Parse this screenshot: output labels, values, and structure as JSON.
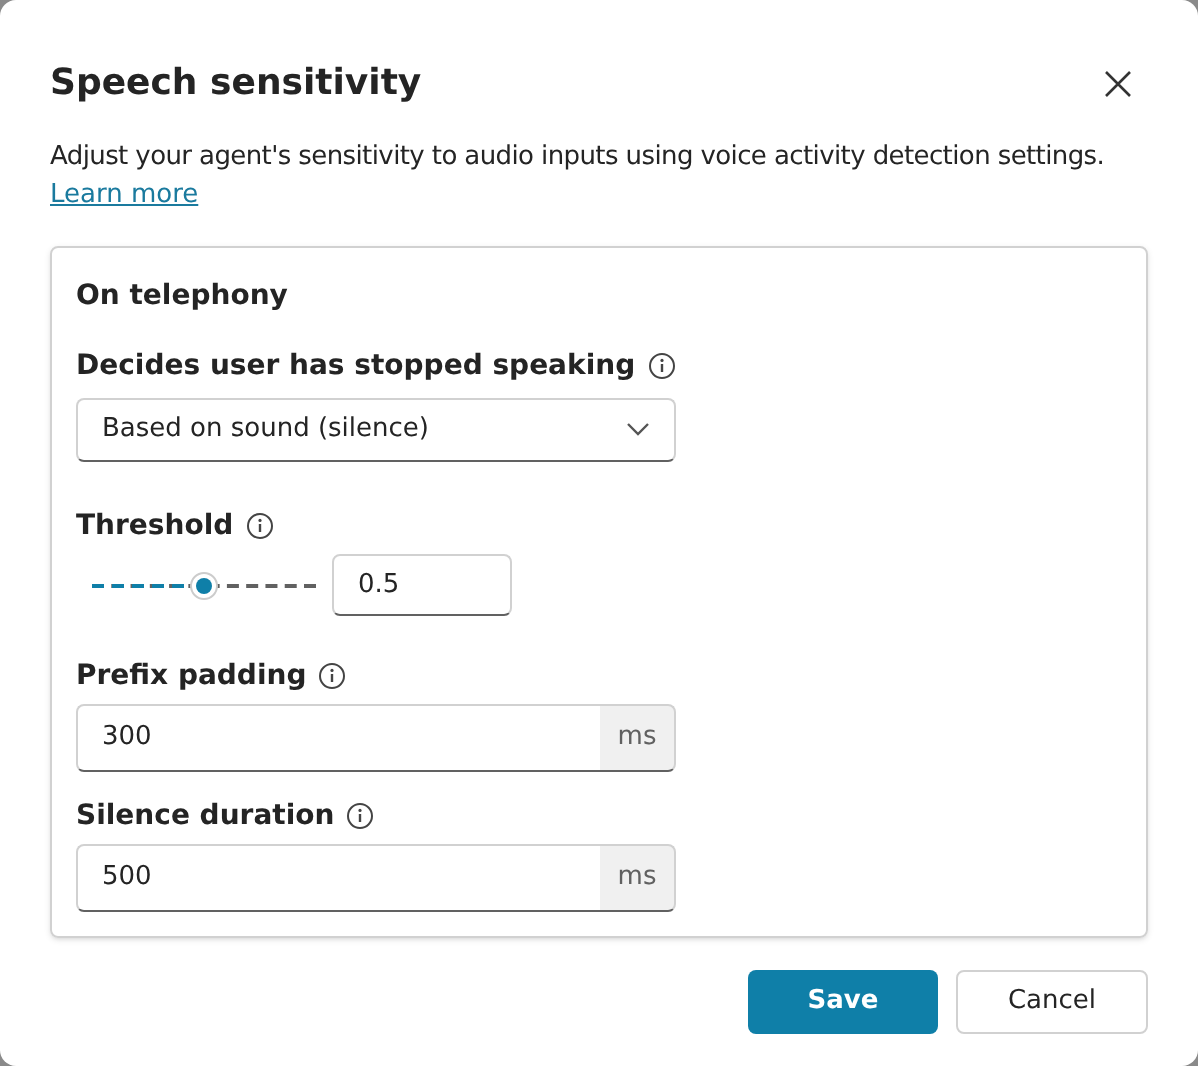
{
  "dialog": {
    "title": "Speech sensitivity",
    "description": "Adjust your agent's sensitivity to audio inputs using voice activity detection settings.",
    "link": "Learn more"
  },
  "section": {
    "title": "On telephony",
    "dropdown": {
      "label": "Decides user has stopped speaking",
      "value": "Based on sound (silence)"
    },
    "threshold": {
      "label": "Threshold",
      "level": 0.5,
      "value": "0.5"
    },
    "fields": [
      {
        "label": "Prefix padding",
        "value": "300",
        "unit": "ms"
      },
      {
        "label": "Silence duration",
        "value": "500",
        "unit": "ms"
      }
    ]
  },
  "buttons": [
    {
      "label": "Save",
      "kind": "primary"
    },
    {
      "label": "Cancel",
      "kind": "secondary"
    }
  ]
}
